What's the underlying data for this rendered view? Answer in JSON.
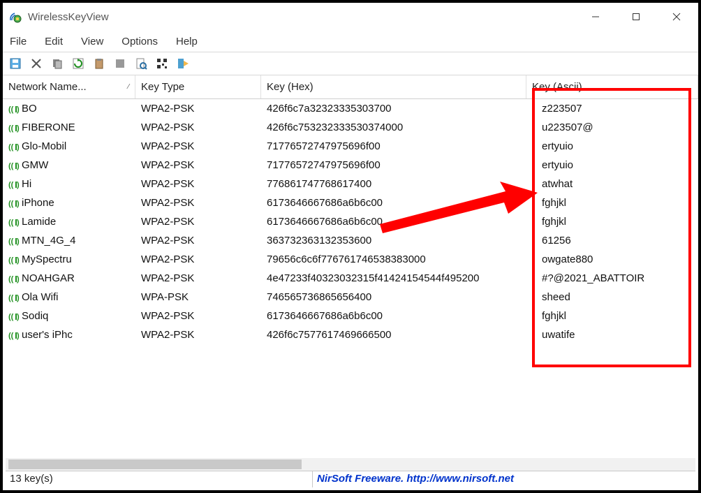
{
  "window": {
    "title": "WirelessKeyView"
  },
  "menu": {
    "file": "File",
    "edit": "Edit",
    "view": "View",
    "options": "Options",
    "help": "Help"
  },
  "columns": {
    "name": "Network Name...",
    "type": "Key Type",
    "hex": "Key (Hex)",
    "ascii": "Key (Ascii)"
  },
  "rows": [
    {
      "name": "BO",
      "type": "WPA2-PSK",
      "hex": "426f6c7a32323335303700",
      "ascii": "z223507"
    },
    {
      "name": "FIBERONE",
      "type": "WPA2-PSK",
      "hex": "426f6c753232333530374000",
      "ascii": "u223507@"
    },
    {
      "name": "Glo-Mobil",
      "type": "WPA2-PSK",
      "hex": "71776572747975696f00",
      "ascii": "ertyuio"
    },
    {
      "name": "GMW",
      "type": "WPA2-PSK",
      "hex": "71776572747975696f00",
      "ascii": "ertyuio"
    },
    {
      "name": "Hi",
      "type": "WPA2-PSK",
      "hex": "77686174776861740​0",
      "ascii": "atwhat"
    },
    {
      "name": "iPhone",
      "type": "WPA2-PSK",
      "hex": "6173646667686a6b6c00",
      "ascii": "fghjkl"
    },
    {
      "name": "Lamide",
      "type": "WPA2-PSK",
      "hex": "6173646667686a6b6c00",
      "ascii": "fghjkl"
    },
    {
      "name": "MTN_4G_4",
      "type": "WPA2-PSK",
      "hex": "363732363132353600",
      "ascii": "61256"
    },
    {
      "name": "MySpectru",
      "type": "WPA2-PSK",
      "hex": "79656c6c6f776761746538383000",
      "ascii": "owgate880"
    },
    {
      "name": "NOAHGAR",
      "type": "WPA2-PSK",
      "hex": "4e47233f40323032315f41424154544f495200",
      "ascii": "#?@2021_ABATTOIR"
    },
    {
      "name": "Ola Wifi",
      "type": "WPA-PSK",
      "hex": "74656573686565640​0",
      "ascii": "sheed"
    },
    {
      "name": "Sodiq",
      "type": "WPA2-PSK",
      "hex": "6173646667686a6b6c00",
      "ascii": "fghjkl"
    },
    {
      "name": "user's iPhc",
      "type": "WPA2-PSK",
      "hex": "426f6c757761746966650​0",
      "ascii": "uwatife"
    }
  ],
  "status": {
    "left": "13 key(s)",
    "right": "NirSoft Freeware.  http://www.nirsoft.net"
  }
}
